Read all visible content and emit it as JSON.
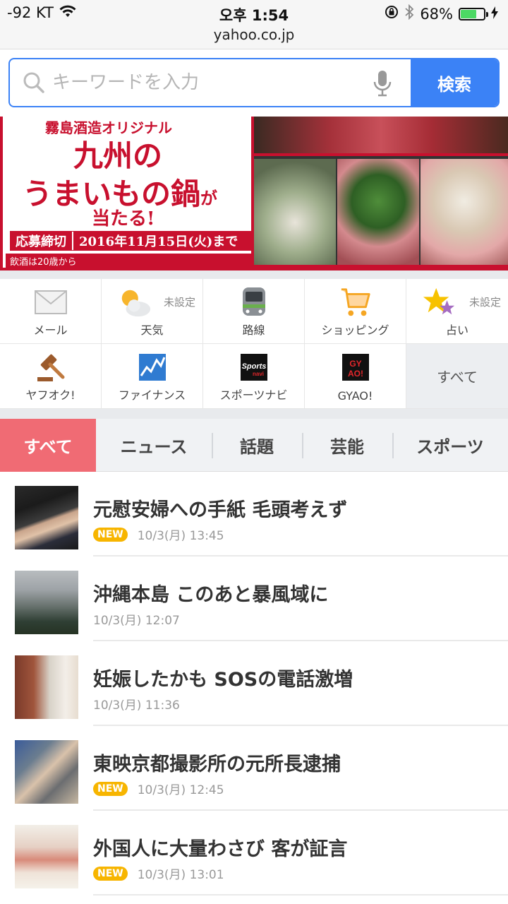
{
  "status": {
    "signal": "-92 KT",
    "time": "오후 1:54",
    "battery_percent": "68%",
    "battery_level": 0.68,
    "url": "yahoo.co.jp"
  },
  "search": {
    "placeholder": "キーワードを入力",
    "button_label": "検索"
  },
  "banner": {
    "top_text": "霧島酒造オリジナル",
    "title_line1": "九州の",
    "title_line2": "うまいもの鍋",
    "title_line2_suffix": "が",
    "title_line3": "当たる!",
    "deadline_label": "応募締切",
    "deadline_date": "2016年11月15日(火)まで",
    "note": "飲酒は20歳から"
  },
  "services": [
    {
      "label": "メール",
      "icon": "mail-icon"
    },
    {
      "label": "天気",
      "icon": "weather-icon",
      "note": "未設定"
    },
    {
      "label": "路線",
      "icon": "train-icon"
    },
    {
      "label": "ショッピング",
      "icon": "cart-icon"
    },
    {
      "label": "占い",
      "icon": "star-icon",
      "note": "未設定"
    },
    {
      "label": "ヤフオク!",
      "icon": "auction-gavel-icon"
    },
    {
      "label": "ファイナンス",
      "icon": "finance-chart-icon"
    },
    {
      "label": "スポーツナビ",
      "icon": "sportsnavi-icon"
    },
    {
      "label": "GYAO!",
      "icon": "gyao-icon"
    },
    {
      "label": "すべて",
      "icon": ""
    }
  ],
  "tabs": [
    "すべて",
    "ニュース",
    "話題",
    "芸能",
    "スポーツ"
  ],
  "news": [
    {
      "title": "元慰安婦への手紙 毛頭考えず",
      "badge": "NEW",
      "time": "10/3(月) 13:45"
    },
    {
      "title": "沖縄本島 このあと暴風域に",
      "badge": "",
      "time": "10/3(月) 12:07"
    },
    {
      "title": "妊娠したかも SOSの電話激増",
      "badge": "",
      "time": "10/3(月) 11:36"
    },
    {
      "title": "東映京都撮影所の元所長逮捕",
      "badge": "NEW",
      "time": "10/3(月) 12:45"
    },
    {
      "title": "外国人に大量わさび 客が証言",
      "badge": "NEW",
      "time": "10/3(月) 13:01"
    }
  ],
  "colors": {
    "accent_blue": "#3b82f6",
    "tab_active": "#f06b74",
    "badge_new": "#f7b500",
    "banner_red": "#c8102e"
  }
}
